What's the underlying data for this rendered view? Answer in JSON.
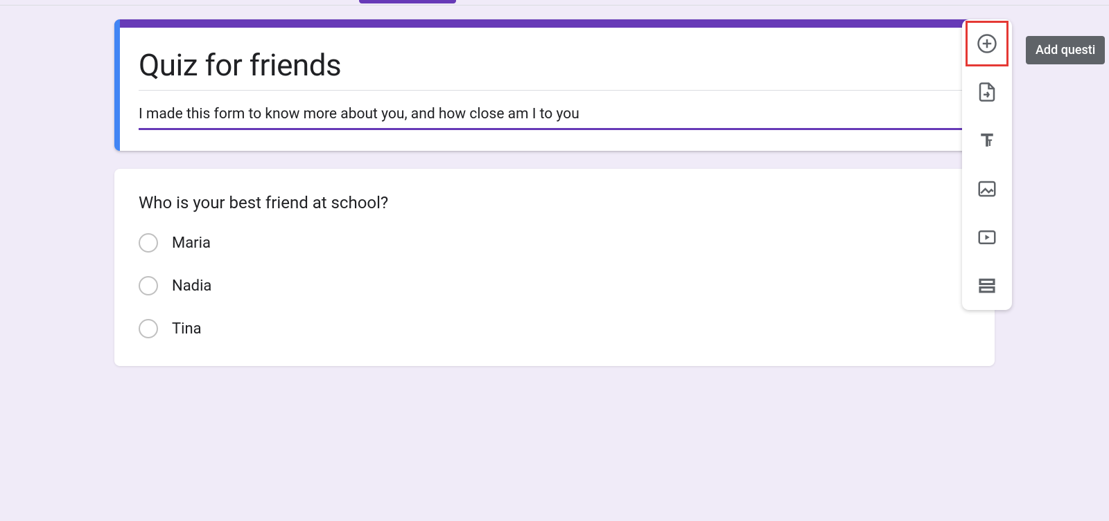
{
  "form": {
    "title": "Quiz for friends",
    "description": "I made this form to know more about you, and how close am I to you"
  },
  "question": {
    "title": "Who is your best friend at school?",
    "options": [
      "Maria",
      "Nadia",
      "Tina"
    ]
  },
  "toolbar": {
    "tooltip": "Add questi",
    "items": {
      "add_question": "add-question",
      "import_questions": "import-questions",
      "add_title": "add-title-description",
      "add_image": "add-image",
      "add_video": "add-video",
      "add_section": "add-section"
    }
  },
  "colors": {
    "theme": "#673ab7",
    "accent": "#4285f4",
    "highlight": "#e53935"
  }
}
